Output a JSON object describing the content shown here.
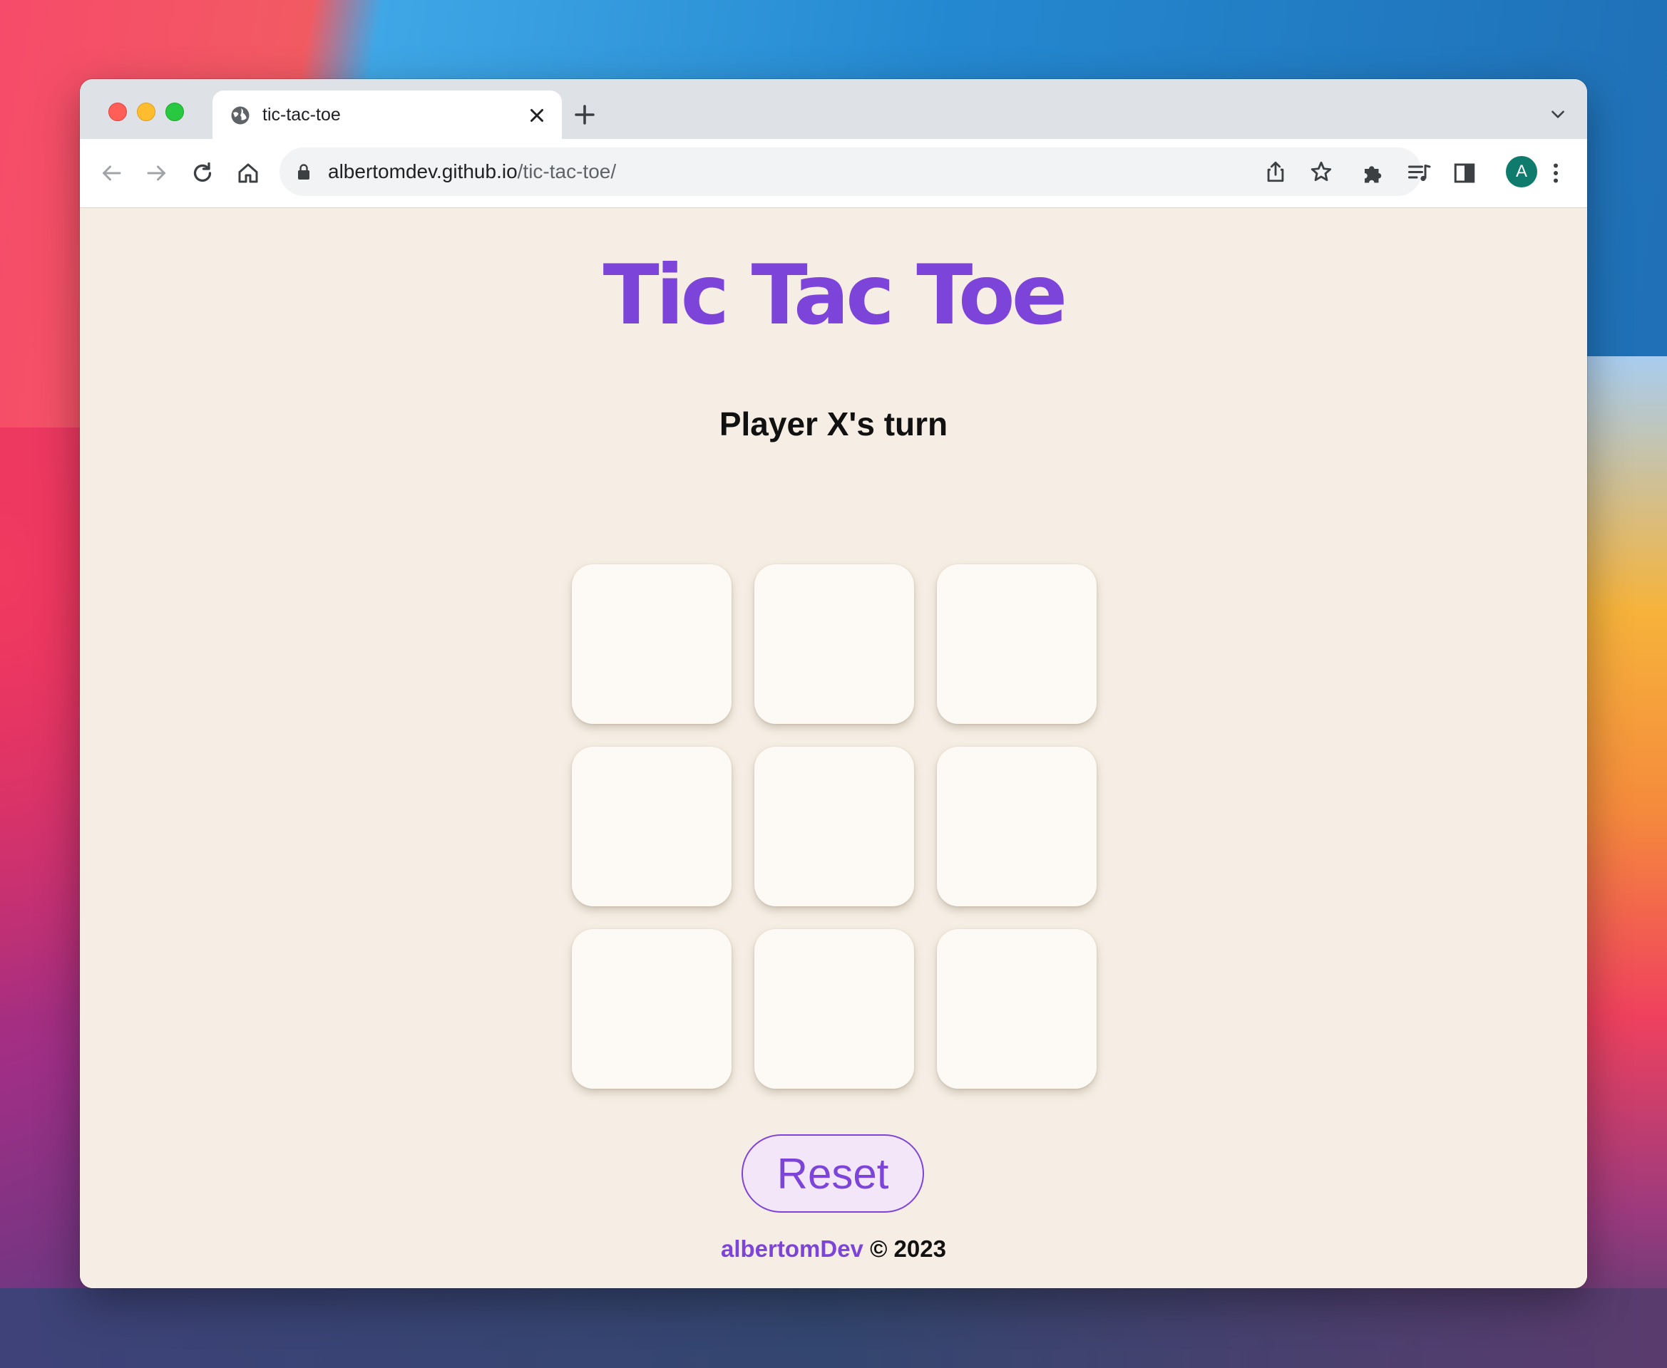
{
  "browser": {
    "tab_title": "tic-tac-toe",
    "url_host": "albertomdev.github.io",
    "url_path": "/tic-tac-toe/",
    "profile_initial": "A",
    "profile_color": "#0f7b6c"
  },
  "icons": {
    "tab": "globe-icon",
    "tab_close": "close-icon",
    "new_tab": "plus-icon",
    "tab_menu": "chevron-down-icon",
    "back": "arrow-left-icon",
    "forward": "arrow-right-icon",
    "reload": "reload-icon",
    "home": "home-icon",
    "lock": "lock-icon",
    "share": "share-icon",
    "bookmark": "star-icon",
    "extensions": "puzzle-icon",
    "reading_list": "playlist-icon",
    "side_panel": "side-panel-icon",
    "menu": "kebab-menu-icon"
  },
  "game": {
    "title": "Tic Tac Toe",
    "status": "Player X's turn",
    "board": [
      "",
      "",
      "",
      "",
      "",
      "",
      "",
      "",
      ""
    ],
    "reset_label": "Reset"
  },
  "footer": {
    "author": "albertomDev",
    "copyright": "© 2023"
  },
  "colors": {
    "accent": "#7d44d9",
    "page_background": "#f6eee4",
    "cell_background": "#fdfaf5",
    "button_background": "#f3e6f8"
  }
}
